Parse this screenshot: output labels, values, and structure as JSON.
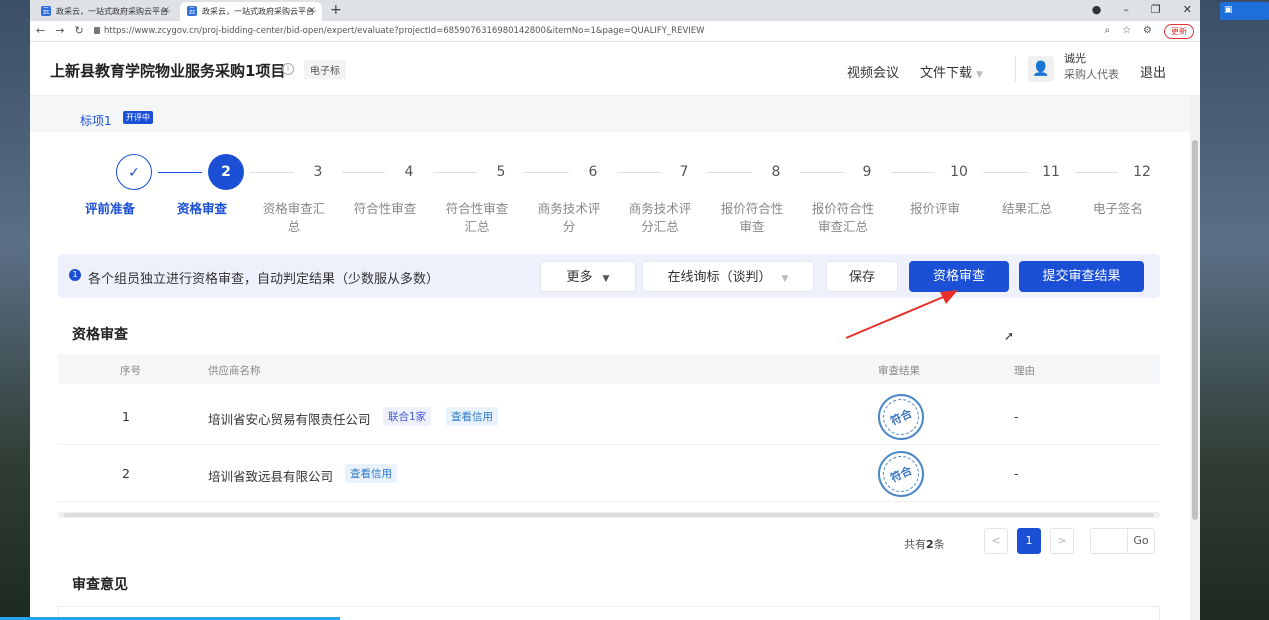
{
  "browser": {
    "tabs": [
      {
        "title": "政采云，一站式政府采购云平台·"
      },
      {
        "title": "政采云，一站式政府采购云平台·"
      }
    ],
    "url": "https://www.zcygov.cn/proj-bidding-center/bid-open/expert/evaluate?projectId=6859076316980142800&itemNo=1&page=QUALIFY_REVIEW",
    "update_label": "更新"
  },
  "header": {
    "title": "上新县教育学院物业服务采购1项目",
    "tag": "电子标",
    "links": {
      "video": "视频会议",
      "download": "文件下载"
    },
    "user": {
      "name": "诚光",
      "role": "采购人代表"
    },
    "logout": "退出"
  },
  "lot": {
    "label": "标项1",
    "badge": "开评中"
  },
  "steps": [
    {
      "num": "✓",
      "label1": "评前准备",
      "label2": ""
    },
    {
      "num": "2",
      "label1": "资格审查",
      "label2": ""
    },
    {
      "num": "3",
      "label1": "资格审查汇",
      "label2": "总"
    },
    {
      "num": "4",
      "label1": "符合性审查",
      "label2": ""
    },
    {
      "num": "5",
      "label1": "符合性审查",
      "label2": "汇总"
    },
    {
      "num": "6",
      "label1": "商务技术评",
      "label2": "分"
    },
    {
      "num": "7",
      "label1": "商务技术评",
      "label2": "分汇总"
    },
    {
      "num": "8",
      "label1": "报价符合性",
      "label2": "审查"
    },
    {
      "num": "9",
      "label1": "报价符合性",
      "label2": "审查汇总"
    },
    {
      "num": "10",
      "label1": "报价评审",
      "label2": ""
    },
    {
      "num": "11",
      "label1": "结果汇总",
      "label2": ""
    },
    {
      "num": "12",
      "label1": "电子签名",
      "label2": ""
    }
  ],
  "action_bar": {
    "notice_icon": "1",
    "notice": "各个组员独立进行资格审查，自动判定结果（少数服从多数）",
    "more": "更多",
    "online_inquiry": "在线询标（谈判）",
    "save": "保存",
    "qualify_review": "资格审查",
    "submit": "提交审查结果"
  },
  "section_title": "资格审查",
  "table": {
    "headers": {
      "index": "序号",
      "supplier": "供应商名称",
      "result": "审查结果",
      "reason": "理由"
    },
    "rows": [
      {
        "index": "1",
        "supplier": "培训省安心贸易有限责任公司",
        "tag1": "联合1家",
        "tag2": "查看信用",
        "result": "符合",
        "reason": "-"
      },
      {
        "index": "2",
        "supplier": "培训省致远县有限公司",
        "tag1": "",
        "tag2": "查看信用",
        "result": "符合",
        "reason": "-"
      }
    ]
  },
  "pagination": {
    "prefix": "共有",
    "count": "2",
    "suffix": "条",
    "current": "1",
    "prev": "<",
    "next": ">",
    "go": "Go"
  },
  "opinion_title": "审查意见",
  "colors": {
    "primary": "#1a4fd6",
    "stamp": "#4a86c8",
    "arrow": "#e8312a"
  }
}
